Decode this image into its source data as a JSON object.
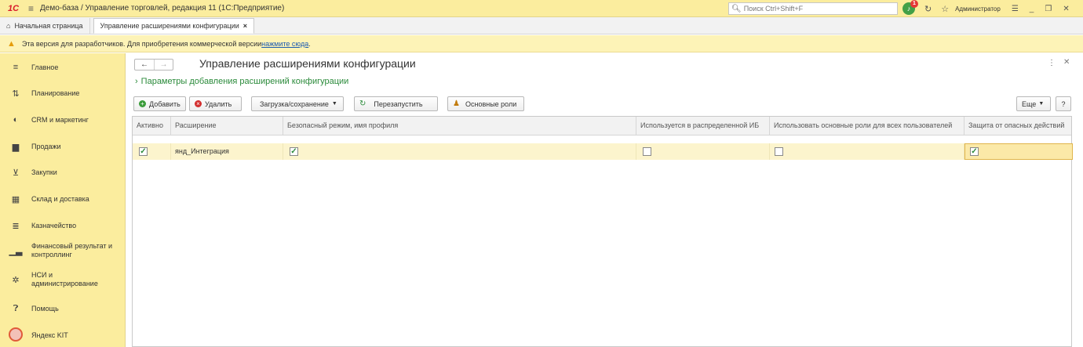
{
  "titlebar": {
    "logo": "1С",
    "title": "Демо-база / Управление торговлей, редакция 11  (1С:Предприятие)",
    "search_placeholder": "Поиск Ctrl+Shift+F",
    "notifications_count": "1",
    "user": "Администратор"
  },
  "tabs": [
    {
      "label": "Начальная страница"
    },
    {
      "label": "Управление расширениями конфигурации"
    }
  ],
  "warning": {
    "text": "Эта версия для разработчиков. Для приобретения коммерческой версии ",
    "link": "нажмите сюда",
    "suffix": "."
  },
  "sidebar": {
    "items": [
      {
        "label": "Главное",
        "icon": "menu-icon"
      },
      {
        "label": "Планирование",
        "icon": "planning-icon"
      },
      {
        "label": "CRM и маркетинг",
        "icon": "crm-icon"
      },
      {
        "label": "Продажи",
        "icon": "sales-icon"
      },
      {
        "label": "Закупки",
        "icon": "cart-icon"
      },
      {
        "label": "Склад и доставка",
        "icon": "warehouse-icon"
      },
      {
        "label": "Казначейство",
        "icon": "treasury-icon"
      },
      {
        "label": "Финансовый результат и контроллинг",
        "icon": "chart-icon"
      },
      {
        "label": "НСИ и администрирование",
        "icon": "gear-icon"
      },
      {
        "label": "Помощь",
        "icon": "help-icon"
      },
      {
        "label": "Яндекс KIT",
        "icon": "yandex-icon"
      }
    ]
  },
  "main": {
    "title": "Управление расширениями конфигурации",
    "params_link": "Параметры добавления расширений конфигурации",
    "buttons": {
      "add": "Добавить",
      "delete": "Удалить",
      "load_save": "Загрузка/сохранение",
      "restart": "Перезапустить",
      "main_roles": "Основные роли",
      "more": "Еще",
      "help": "?"
    },
    "columns": [
      "Активно",
      "Расширение",
      "Безопасный режим, имя профиля",
      "Используется в распределенной ИБ",
      "Использовать основные роли для всех пользователей",
      "Защита от опасных действий"
    ],
    "rows": [
      {
        "active": true,
        "extension": "янд_Интеграция",
        "safe_mode": true,
        "distributed": false,
        "main_roles_all": false,
        "protection": true
      }
    ]
  },
  "colors": {
    "sidebar_bg": "#fbed9e",
    "warning_bg": "#fdf3b7",
    "accent_green": "#2a8a3a",
    "row_highlight": "#fcf4cd"
  }
}
